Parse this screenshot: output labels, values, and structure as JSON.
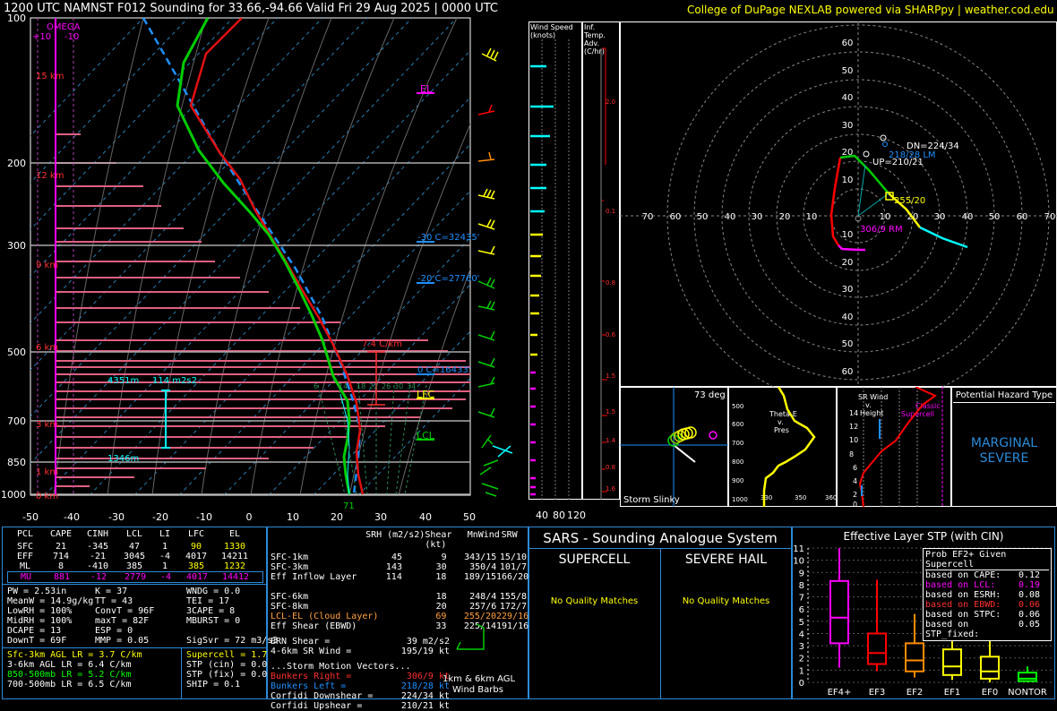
{
  "header": {
    "title": "1200 UTC NAMNST F012 Sounding for 33.66,-94.66 Valid  Fri 29 Aug 2025 | 0000 UTC",
    "credit": "College of DuPage NEXLAB powered via SHARPpy | weather.cod.edu"
  },
  "skewt": {
    "pressure_ticks": [
      "100",
      "200",
      "300",
      "500",
      "700",
      "850",
      "1000"
    ],
    "temp_ticks": [
      "-50",
      "-40",
      "-30",
      "-20",
      "-10",
      "0",
      "10",
      "20",
      "30",
      "40",
      "50"
    ],
    "height_labels": [
      "15 km",
      "12 km",
      "9 km",
      "6 km",
      "3 km",
      "1 km",
      "0 km"
    ],
    "omega_label": "OMEGA",
    "omega_scale": [
      "+10",
      "-10"
    ],
    "el_label": "EL",
    "lfc_label": "LFC",
    "lcl_label": "LCL",
    "lapse_label": "7.4 C/km",
    "level_m30": "-30 C=32435'",
    "level_m20": "-20 C=27760'",
    "level_0": "0 C=16433'",
    "eil_top": "4351m",
    "eil_srh": "114 m2s2",
    "eil_bot": "1346m",
    "sfc_temp": "71",
    "rh_ticks": [
      "6",
      "14",
      "18",
      "22",
      "26",
      "30",
      "34"
    ]
  },
  "wind_speed": {
    "title": "Wind Speed (knots)",
    "ticks": [
      "40",
      "80",
      "120"
    ]
  },
  "inf_temp": {
    "title": "Inf. Temp. Adv. (C/hr)",
    "ticks": [
      "2.0",
      "0.1",
      "0.8",
      "0.6",
      "1.5",
      "1.5",
      "1.4",
      "0.8",
      "1.6"
    ]
  },
  "hodograph": {
    "rings_pos": [
      "10",
      "20",
      "30",
      "40",
      "50",
      "60"
    ],
    "xticks_left": [
      "70",
      "60",
      "50",
      "40",
      "30",
      "20",
      "10"
    ],
    "xticks_right": [
      "10",
      "20",
      "30",
      "40",
      "50",
      "60",
      "70"
    ],
    "dn_label": "DN=224/34",
    "lm_label": "218/28 LM",
    "up_label": "UP=210/21",
    "mean_label": "255/20",
    "rm_label": "306/9 RM"
  },
  "slinky": {
    "title": "Storm Slinky",
    "deg": "73 deg"
  },
  "theta": {
    "title1": "Theta-E",
    "title2": "v.",
    "title3": "Pres",
    "pticks": [
      "500",
      "600",
      "700",
      "800",
      "900",
      "1000"
    ],
    "xticks": [
      "330",
      "350",
      "360"
    ]
  },
  "srwind": {
    "title1": "SR Wind",
    "title2": "v.",
    "title3": "Height",
    "hticks": [
      "14",
      "12",
      "10",
      "8",
      "6",
      "4",
      "2",
      "0"
    ],
    "label1": "Classic",
    "label2": "Supercell"
  },
  "hazard": {
    "title": "Potential Hazard Type",
    "value1": "MARGINAL",
    "value2": "SEVERE"
  },
  "parcels": {
    "headers": [
      "PCL",
      "CAPE",
      "CINH",
      "LCL",
      "LI",
      "LFC",
      "EL"
    ],
    "rows": [
      [
        "SFC",
        "21",
        "-345",
        "47",
        "1",
        "90",
        "1330"
      ],
      [
        "EFF",
        "714",
        "-21",
        "3045",
        "-4",
        "4017",
        "14211"
      ],
      [
        "ML",
        "8",
        "-410",
        "385",
        "1",
        "385",
        "1232"
      ],
      [
        "MU",
        "881",
        "-12",
        "2779",
        "-4",
        "4017",
        "14412"
      ]
    ]
  },
  "thermo": {
    "c1": [
      "PW = 2.53in",
      "MeanW = 14.9g/kg",
      "LowRH = 100%",
      "MidRH = 100%",
      "DCAPE = 13",
      "DownT = 69F"
    ],
    "c2": [
      "K = 37",
      "TT = 43",
      "ConvT = 96F",
      "maxT = 82F",
      "ESP = 0",
      "MMP = 0.05"
    ],
    "c3": [
      "WNDG = 0.0",
      "TEI = 17",
      "3CAPE = 8",
      "MBURST = 0",
      "",
      "SigSvr = 72 m3/s3"
    ]
  },
  "lapse": {
    "rows": [
      "Sfc-3km AGL LR = 3.7 C/km",
      "3-6km AGL LR = 6.4 C/km",
      "850-500mb LR = 5.2 C/km",
      "700-500mb LR = 6.5 C/km"
    ],
    "rows2": [
      "Supercell = 1.7",
      "STP (cin) = 0.0",
      "STP (fix) = 0.0",
      "SHIP = 0.1"
    ]
  },
  "kin": {
    "headers": [
      "SRH (m2/s2)",
      "Shear (kt)",
      "MnWind",
      "SRW"
    ],
    "rows": [
      [
        "SFC-1km",
        "45",
        "9",
        "343/15",
        "15/10"
      ],
      [
        "SFC-3km",
        "143",
        "30",
        "350/4",
        "101/7"
      ],
      [
        "Eff Inflow Layer",
        "114",
        "18",
        "189/15",
        "166/20"
      ],
      [
        "",
        "",
        "",
        "",
        ""
      ],
      [
        "SFC-6km",
        "",
        "18",
        "248/4",
        "155/8"
      ],
      [
        "SFC-8km",
        "",
        "20",
        "257/6",
        "172/7"
      ],
      [
        "LCL-EL (Cloud Layer)",
        "",
        "69",
        "255/20",
        "229/16"
      ],
      [
        "Eff Shear (EBWD)",
        "",
        "33",
        "225/14",
        "191/16"
      ]
    ],
    "brn_shear": [
      "BRN Shear =",
      "39 m2/s2"
    ],
    "srwind46": [
      "4-6km SR Wind =",
      "195/19 kt"
    ],
    "storm_title": "...Storm Motion Vectors...",
    "storm": [
      [
        "Bunkers Right =",
        "306/9 kt"
      ],
      [
        "Bunkers Left =",
        "218/28 kt"
      ],
      [
        "Corfidi Downshear =",
        "224/34 kt"
      ],
      [
        "Corfidi Upshear =",
        "210/21 kt"
      ]
    ],
    "barb_caption1": "1km & 6km AGL",
    "barb_caption2": "Wind Barbs"
  },
  "sars": {
    "title": "SARS - Sounding Analogue System",
    "supercell": "SUPERCELL",
    "hail": "SEVERE HAIL",
    "sc_matches": "No Quality Matches",
    "hail_matches": "No Quality Matches"
  },
  "stp": {
    "title": "Effective Layer STP (with CIN)",
    "prob_title": "Prob EF2+ Given Supercell",
    "prob": [
      [
        "based on CAPE:",
        "0.12"
      ],
      [
        "based on LCL:",
        "0.19"
      ],
      [
        "based on ESRH:",
        "0.08"
      ],
      [
        "based on EBWD:",
        "0.06"
      ],
      [
        "based on STPC:",
        "0.06"
      ],
      [
        "based on STP_fixed:",
        "0.05"
      ]
    ],
    "yticks": [
      "11",
      "10",
      "9",
      "8",
      "7",
      "6",
      "5",
      "4",
      "3",
      "2",
      "1",
      "0"
    ],
    "categories": [
      "EF4+",
      "EF3",
      "EF2",
      "EF1",
      "EF0",
      "NONTOR"
    ]
  },
  "chart_data": {
    "type": "box",
    "title": "Effective Layer STP (with CIN)",
    "categories": [
      "EF4+",
      "EF3",
      "EF2",
      "EF1",
      "EF0",
      "NONTOR"
    ],
    "ylim": [
      0,
      11
    ],
    "boxes": [
      {
        "name": "EF4+",
        "whisker_low": 1.2,
        "q1": 3.2,
        "median": 5.3,
        "q3": 8.3,
        "whisker_high": 11.0,
        "color": "#ff00ff"
      },
      {
        "name": "EF3",
        "whisker_low": 0.9,
        "q1": 1.5,
        "median": 2.4,
        "q3": 4.0,
        "whisker_high": 8.4,
        "color": "#ff0000"
      },
      {
        "name": "EF2",
        "whisker_low": 0.4,
        "q1": 0.9,
        "median": 1.8,
        "q3": 3.2,
        "whisker_high": 5.6,
        "color": "#ff8c00"
      },
      {
        "name": "EF1",
        "whisker_low": 0.2,
        "q1": 0.6,
        "median": 1.3,
        "q3": 2.7,
        "whisker_high": 4.2,
        "color": "#ffff00"
      },
      {
        "name": "EF0",
        "whisker_low": 0.0,
        "q1": 0.3,
        "median": 0.9,
        "q3": 2.1,
        "whisker_high": 3.7,
        "color": "#ffff00"
      },
      {
        "name": "NONTOR",
        "whisker_low": 0.0,
        "q1": 0.1,
        "median": 0.3,
        "q3": 0.8,
        "whisker_high": 1.3,
        "color": "#00ff00"
      }
    ]
  },
  "colors": {
    "panel_border": "#2b8bd8",
    "temp": "#ff0000",
    "dewp": "#00cc00",
    "parcel": "#1e90ff",
    "wetbulb": "#00ffff",
    "accent_yellow": "#ffff00",
    "magenta": "#ff00ff"
  }
}
